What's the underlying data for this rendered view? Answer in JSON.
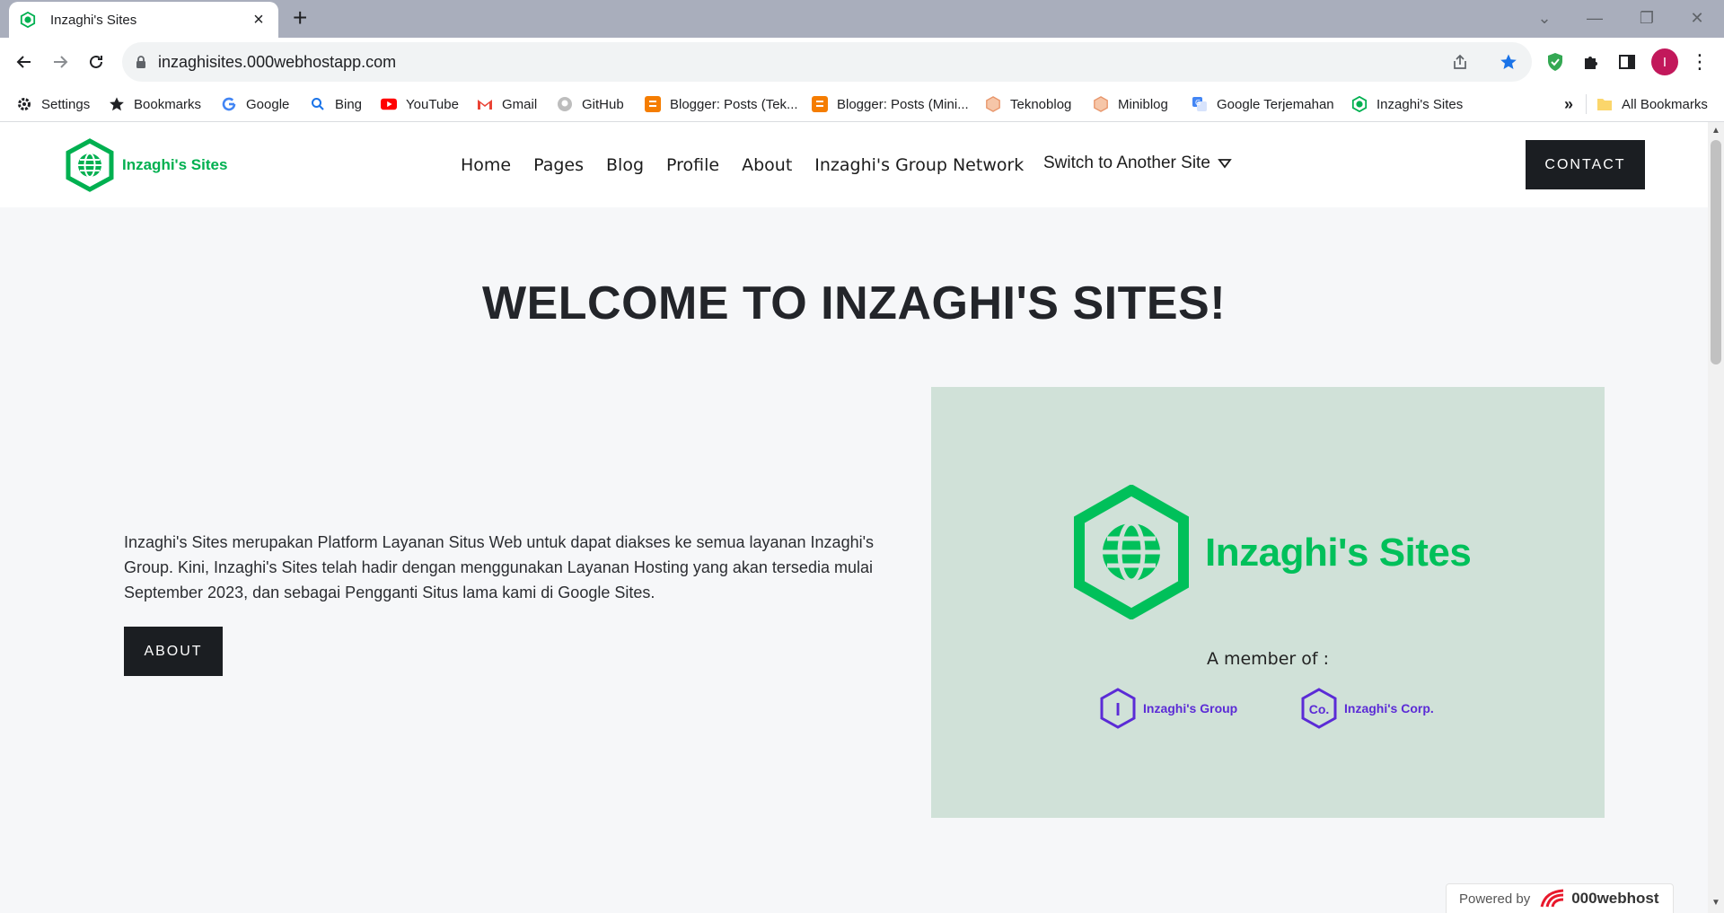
{
  "browser": {
    "tab_title": "Inzaghi's Sites",
    "url": "inzaghisites.000webhostapp.com",
    "avatar_letter": "I"
  },
  "bookmarks": [
    {
      "label": "Settings",
      "icon": "gear-icon"
    },
    {
      "label": "Bookmarks",
      "icon": "star-icon"
    },
    {
      "label": "Google",
      "icon": "google-icon"
    },
    {
      "label": "Bing",
      "icon": "search-icon"
    },
    {
      "label": "YouTube",
      "icon": "youtube-icon"
    },
    {
      "label": "Gmail",
      "icon": "gmail-icon"
    },
    {
      "label": "GitHub",
      "icon": "github-icon"
    },
    {
      "label": "Blogger: Posts (Tek...",
      "icon": "blogger-icon"
    },
    {
      "label": "Blogger: Posts (Mini...",
      "icon": "blogger-icon"
    },
    {
      "label": "Teknoblog",
      "icon": "hexagon-icon"
    },
    {
      "label": "Miniblog",
      "icon": "hexagon-icon"
    },
    {
      "label": "Google Terjemahan",
      "icon": "translate-icon"
    },
    {
      "label": "Inzaghi's Sites",
      "icon": "globe-icon"
    }
  ],
  "bookmarks_overflow": "»",
  "all_bookmarks": "All Bookmarks",
  "site": {
    "brand": "Inzaghi's Sites",
    "nav": [
      "Home",
      "Pages",
      "Blog",
      "Profile",
      "About",
      "Inzaghi's Group Network"
    ],
    "switch_label": "Switch to Another Site",
    "contact_label": "CONTACT",
    "hero_title": "WELCOME TO INZAGHI'S SITES!",
    "intro": "Inzaghi's Sites merupakan Platform Layanan Situs Web untuk dapat diakses ke semua layanan Inzaghi's Group. Kini, Inzaghi's Sites telah hadir dengan menggunakan Layanan Hosting yang akan tersedia mulai September 2023, dan sebagai Pengganti Situs lama kami di Google Sites.",
    "about_label": "ABOUT",
    "promo": {
      "title": "Inzaghi's Sites",
      "member_of": "A member of :",
      "members": [
        {
          "badge": "I",
          "name": "Inzaghi's Group"
        },
        {
          "badge": "Co.",
          "name": "Inzaghi's Corp."
        }
      ]
    },
    "powered_by": "Powered by",
    "powered_brand": "000webhost"
  },
  "colors": {
    "brand_green": "#00b050",
    "member_purple": "#5b2bd6",
    "dark_button": "#1b1e22",
    "promo_bg": "#d0e1d8"
  }
}
